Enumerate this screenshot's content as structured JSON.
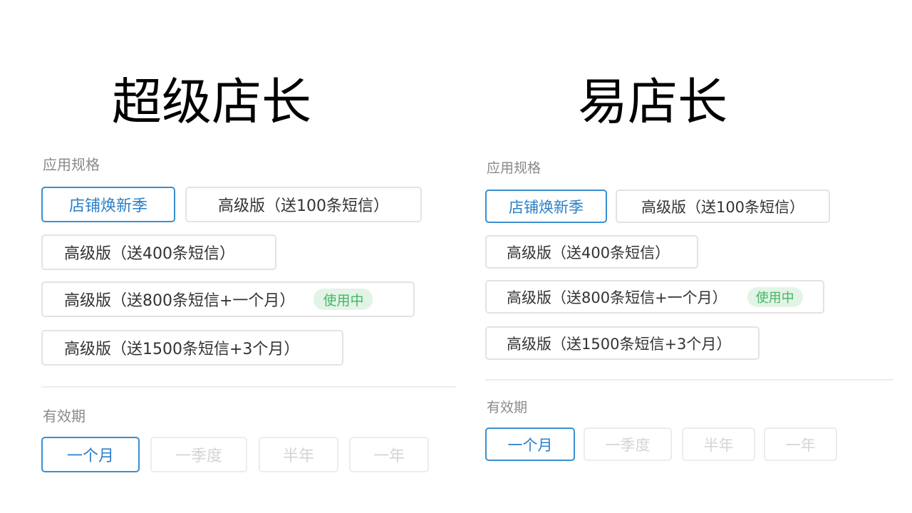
{
  "left": {
    "title": "超级店长",
    "spec_label": "应用规格",
    "specs": [
      {
        "label": "店铺焕新季",
        "state": "selected"
      },
      {
        "label": "高级版（送100条短信）",
        "state": "normal"
      },
      {
        "label": "高级版（送400条短信）",
        "state": "normal"
      },
      {
        "label": "高级版（送800条短信+一个月）",
        "state": "normal",
        "badge": "使用中"
      },
      {
        "label": "高级版（送1500条短信+3个月）",
        "state": "normal"
      }
    ],
    "period_label": "有效期",
    "periods": [
      {
        "label": "一个月",
        "state": "selected"
      },
      {
        "label": "一季度",
        "state": "disabled"
      },
      {
        "label": "半年",
        "state": "disabled"
      },
      {
        "label": "一年",
        "state": "disabled"
      }
    ]
  },
  "right": {
    "title": "易店长",
    "spec_label": "应用规格",
    "specs": [
      {
        "label": "店铺焕新季",
        "state": "selected"
      },
      {
        "label": "高级版（送100条短信）",
        "state": "normal"
      },
      {
        "label": "高级版（送400条短信）",
        "state": "normal"
      },
      {
        "label": "高级版（送800条短信+一个月）",
        "state": "normal",
        "badge": "使用中"
      },
      {
        "label": "高级版（送1500条短信+3个月）",
        "state": "normal"
      }
    ],
    "period_label": "有效期",
    "periods": [
      {
        "label": "一个月",
        "state": "selected"
      },
      {
        "label": "一季度",
        "state": "disabled"
      },
      {
        "label": "半年",
        "state": "disabled"
      },
      {
        "label": "一年",
        "state": "disabled"
      }
    ]
  },
  "colors": {
    "selected_border": "#3a8fd0",
    "selected_text": "#2a7fc8",
    "badge_bg": "#e3f4e6",
    "badge_text": "#46b566",
    "disabled_text": "#d4d4d4"
  }
}
